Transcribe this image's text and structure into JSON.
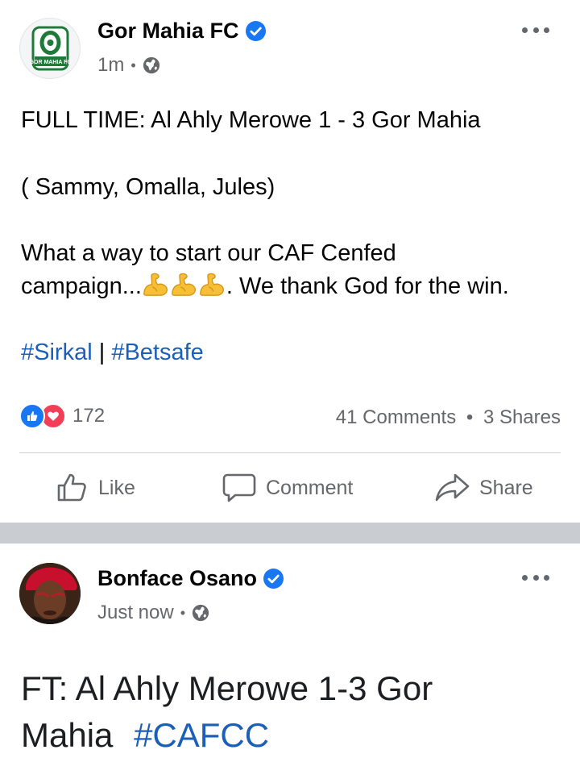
{
  "post1": {
    "author": "Gor Mahia FC",
    "verified": true,
    "time": "1m",
    "privacy_icon": "globe-icon",
    "more_icon": "more-horizontal-icon",
    "avatar_label": "GOR MAHIA FC",
    "lines": {
      "l1": "FULL TIME: Al Ahly Merowe 1 - 3 Gor Mahia",
      "l2": "( Sammy, Omalla, Jules)",
      "l3": "What a way to start our CAF Cenfed",
      "l4a": "campaign...",
      "l4b": ". We thank God for the win."
    },
    "emoji": "flexed-biceps-emoji",
    "hashtags": {
      "h1": "#Sirkal",
      "sep": "|",
      "h2": "#Betsafe"
    },
    "reactions": {
      "count": "172",
      "types": [
        "like",
        "love"
      ]
    },
    "comments": "41 Comments",
    "shares": "3 Shares",
    "actions": {
      "like": "Like",
      "comment": "Comment",
      "share": "Share"
    }
  },
  "post2": {
    "author": "Bonface Osano",
    "verified": true,
    "time": "Just now",
    "privacy_icon": "globe-icon",
    "more_icon": "more-horizontal-icon",
    "text_line1": "FT: Al Ahly Merowe 1-3 Gor",
    "text_line2": "Mahia",
    "hashtag": "#CAFCC"
  },
  "colors": {
    "link": "#1c5fb9",
    "verified": "#1877f2",
    "like": "#1877f2",
    "love": "#f33e58",
    "secondary_text": "#65676b",
    "separator": "#c9ccd1"
  }
}
